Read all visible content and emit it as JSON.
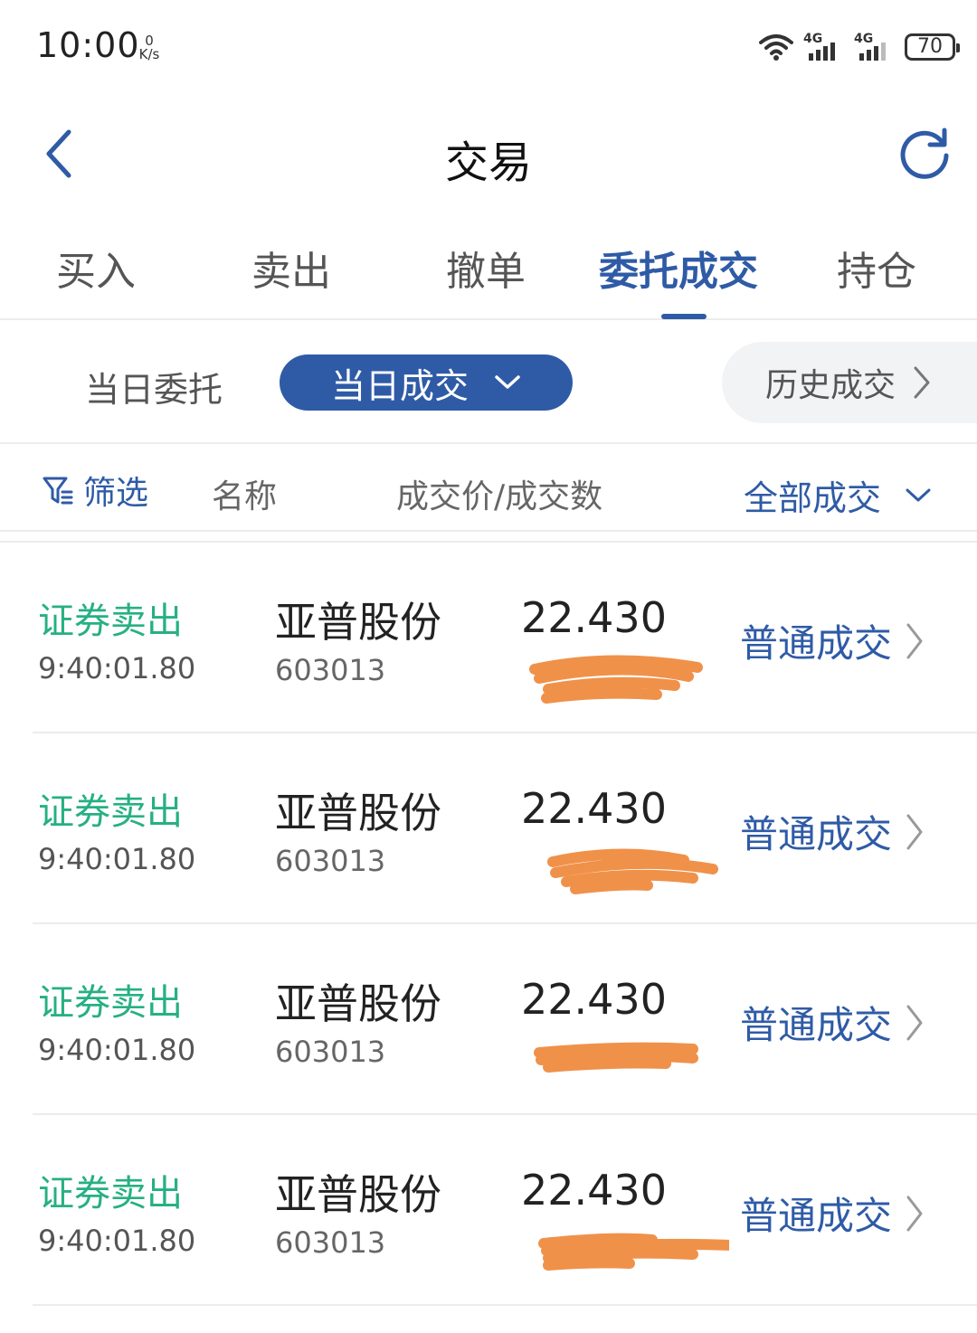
{
  "status_bar": {
    "time": "10:00",
    "net_speed_value": "0",
    "net_speed_unit": "K/s",
    "network_tag_1": "4G",
    "network_tag_2": "4G",
    "battery": "70",
    "icons": [
      "wifi-icon",
      "signal-icon",
      "signal-icon",
      "battery-icon"
    ]
  },
  "header": {
    "title": "交易",
    "back_icon": "chevron-left-icon",
    "refresh_icon": "refresh-icon"
  },
  "tabs": [
    {
      "label": "买入",
      "active": false
    },
    {
      "label": "卖出",
      "active": false
    },
    {
      "label": "撤单",
      "active": false
    },
    {
      "label": "委托成交",
      "active": true
    },
    {
      "label": "持仓",
      "active": false
    }
  ],
  "subfilters": {
    "today_orders": "当日委托",
    "today_trades": "当日成交",
    "history_trades": "历史成交"
  },
  "columns": {
    "filter": "筛选",
    "name": "名称",
    "price_qty": "成交价/成交数",
    "all_trades": "全部成交"
  },
  "rows": [
    {
      "type": "证券卖出",
      "time": "9:40:01.80",
      "name": "亚普股份",
      "code": "603013",
      "price": "22.430",
      "kind": "普通成交"
    },
    {
      "type": "证券卖出",
      "time": "9:40:01.80",
      "name": "亚普股份",
      "code": "603013",
      "price": "22.430",
      "kind": "普通成交"
    },
    {
      "type": "证券卖出",
      "time": "9:40:01.80",
      "name": "亚普股份",
      "code": "603013",
      "price": "22.430",
      "kind": "普通成交"
    },
    {
      "type": "证券卖出",
      "time": "9:40:01.80",
      "name": "亚普股份",
      "code": "603013",
      "price": "22.430",
      "kind": "普通成交"
    }
  ],
  "colors": {
    "accent": "#2f5ba6",
    "sell_green": "#26b083",
    "redaction": "#f0914a"
  }
}
